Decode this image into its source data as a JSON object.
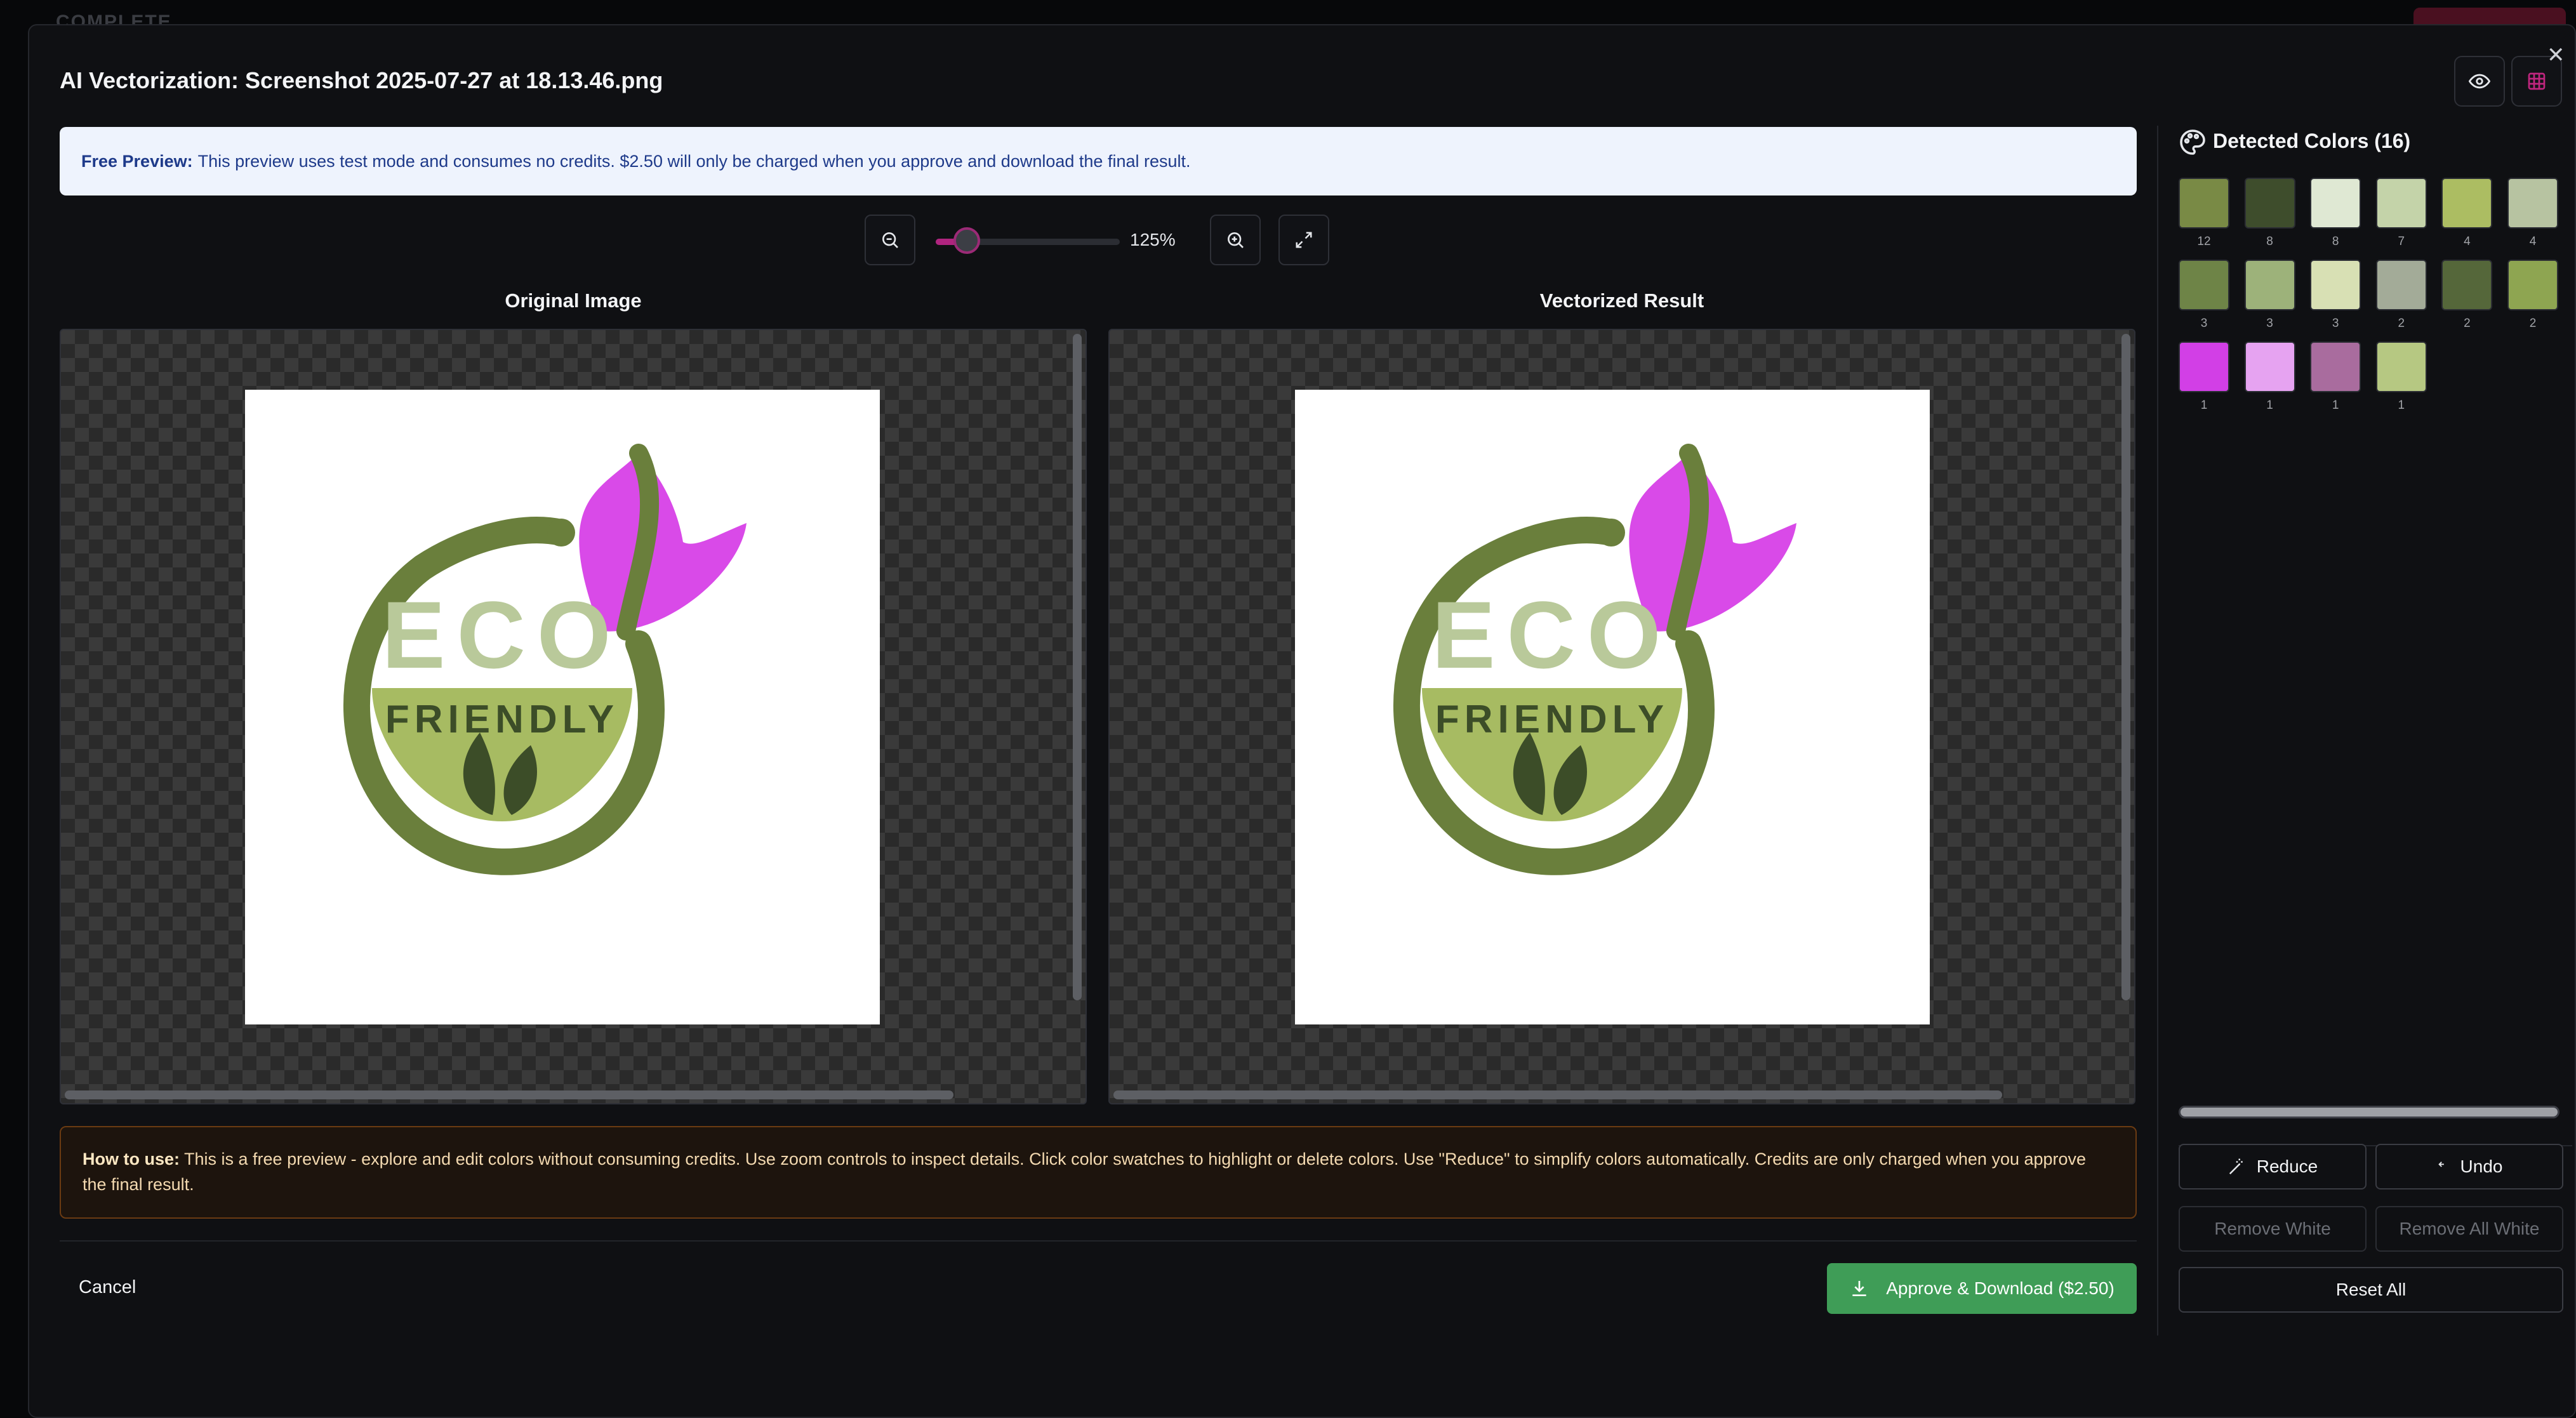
{
  "background": {
    "brand": "COMPLETE"
  },
  "modal": {
    "title": "AI Vectorization: Screenshot 2025-07-27 at 18.13.46.png",
    "info_label": "Free Preview:",
    "info_text": "This preview uses test mode and consumes no credits. $2.50 will only be charged when you approve and download the final result.",
    "zoom": {
      "value_text": "125%",
      "slider_fraction": 0.17
    },
    "panes": {
      "original_title": "Original Image",
      "result_title": "Vectorized Result",
      "logo_top_word": "ECO",
      "logo_bottom_word": "FRIENDLY"
    },
    "howto_label": "How to use:",
    "howto_text": "This is a free preview - explore and edit colors without consuming credits. Use zoom controls to inspect details. Click color swatches to highlight or delete colors. Use \"Reduce\" to simplify colors automatically. Credits are only charged when you approve the final result.",
    "cancel_label": "Cancel",
    "approve_label": "Approve & Download ($2.50)"
  },
  "colors_panel": {
    "title": "Detected Colors (16)",
    "swatches": [
      {
        "color": "#798a45",
        "count": "12"
      },
      {
        "color": "#3e4d2c",
        "count": "8"
      },
      {
        "color": "#dfe8d3",
        "count": "8"
      },
      {
        "color": "#c4d3a9",
        "count": "7"
      },
      {
        "color": "#acbd62",
        "count": "4"
      },
      {
        "color": "#b7c3a1",
        "count": "4"
      },
      {
        "color": "#6e8447",
        "count": "3"
      },
      {
        "color": "#9db27a",
        "count": "3"
      },
      {
        "color": "#d8e0b4",
        "count": "3"
      },
      {
        "color": "#a3ab98",
        "count": "2"
      },
      {
        "color": "#55673a",
        "count": "2"
      },
      {
        "color": "#8ea551",
        "count": "2"
      },
      {
        "color": "#d23fe6",
        "count": "1"
      },
      {
        "color": "#e6a3f1",
        "count": "1"
      },
      {
        "color": "#a96c9e",
        "count": "1"
      },
      {
        "color": "#b6c882",
        "count": "1"
      }
    ],
    "buttons": {
      "reduce": "Reduce",
      "undo": "Undo",
      "remove_white": "Remove White",
      "remove_all_white": "Remove All White",
      "reset_all": "Reset All"
    }
  },
  "colors": {
    "accent_pink": "#b0247f",
    "approve_green": "#3f9d57",
    "logo_dark_green": "#6a7f3c",
    "logo_light_green": "#b9c99a",
    "logo_mid_green": "#a7bb62",
    "logo_leaf_dark": "#3c4d28",
    "logo_magenta": "#d94ae8"
  }
}
